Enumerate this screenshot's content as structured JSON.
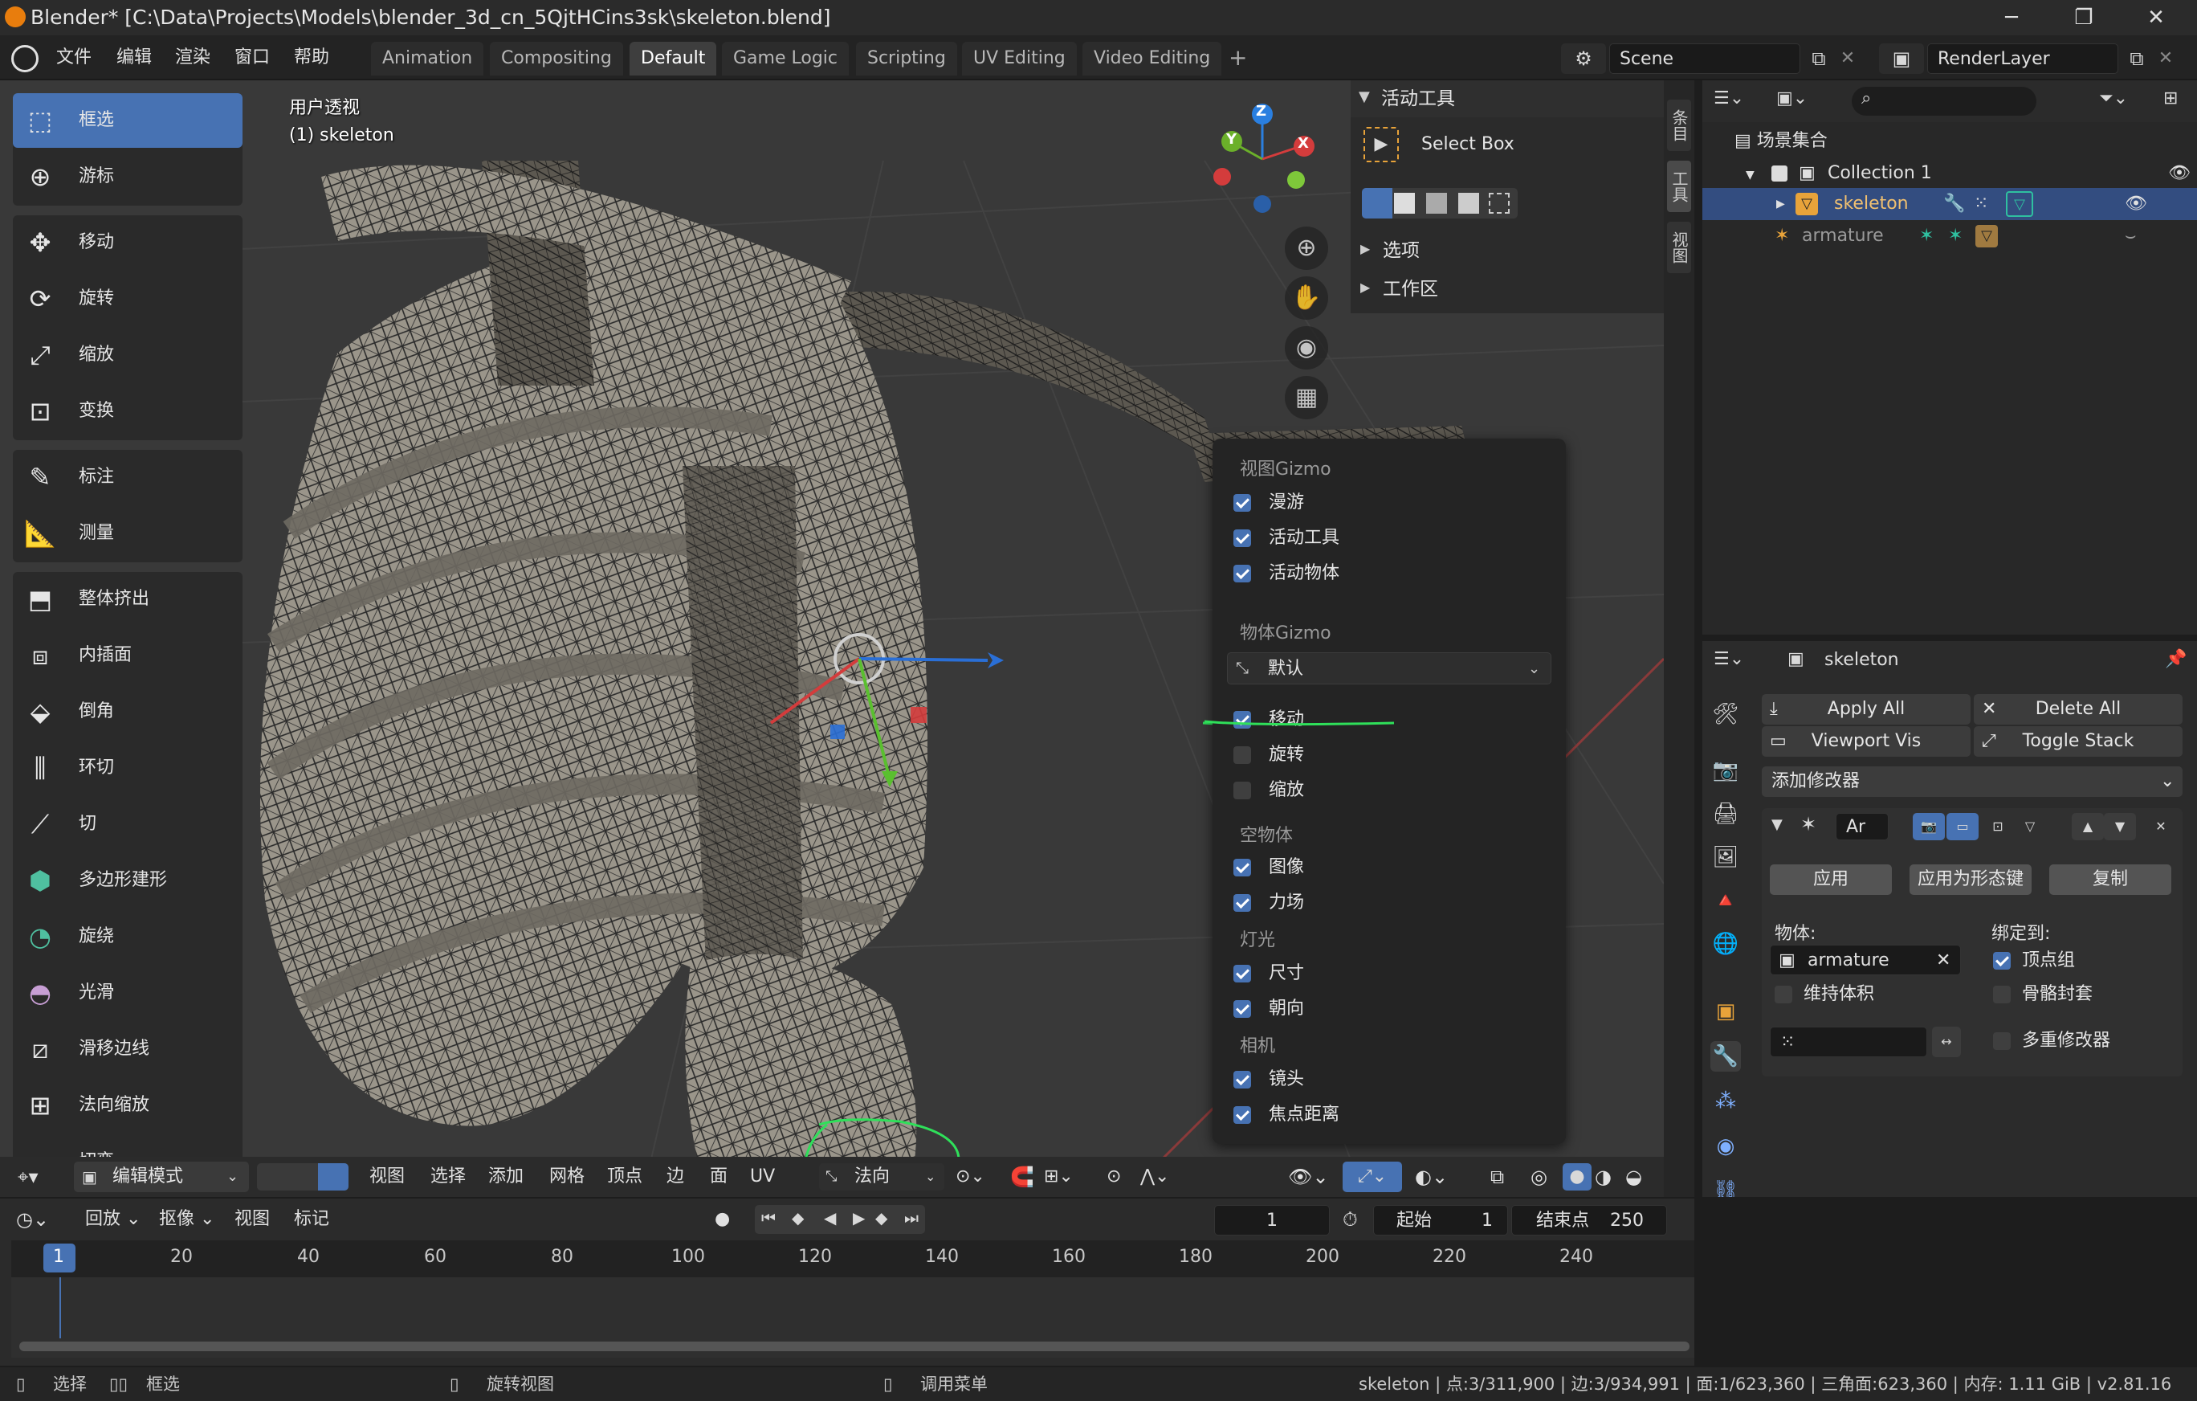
{
  "window": {
    "title": "Blender* [C:\\Data\\Projects\\Models\\blender_3d_cn_5QjtHCins3sk\\skeleton.blend]",
    "minimize": "─",
    "maximize": "❐",
    "close": "✕"
  },
  "menubar": {
    "menus": [
      "文件",
      "编辑",
      "渲染",
      "窗口",
      "帮助"
    ],
    "workspaces": [
      "Animation",
      "Compositing",
      "Default",
      "Game Logic",
      "Scripting",
      "UV Editing",
      "Video Editing"
    ],
    "active_workspace": "Default",
    "add_tab": "+",
    "scene": "Scene",
    "render_layer": "RenderLayer"
  },
  "viewport": {
    "view_name": "用户透视",
    "object_info": "(1) skeleton",
    "tools": [
      "框选",
      "游标",
      "移动",
      "旋转",
      "缩放",
      "变换",
      "标注",
      "测量",
      "整体挤出",
      "内插面",
      "倒角",
      "环切",
      "切",
      "多边形建形",
      "旋绕",
      "光滑",
      "滑移边线",
      "法向缩放",
      "切变"
    ],
    "active_tool": "框选",
    "gizmo_axes": {
      "x": "X",
      "y": "Y",
      "z": "Z"
    }
  },
  "npanel": {
    "section_active_tool": "活动工具",
    "tool_name": "Select Box",
    "section_options": "选项",
    "section_workspace": "工作区",
    "tabs": [
      "条目",
      "工具",
      "视图"
    ]
  },
  "gizmo_popover": {
    "viewport_gizmo_header": "视图Gizmo",
    "viewport_items": [
      {
        "label": "漫游",
        "checked": true
      },
      {
        "label": "活动工具",
        "checked": true
      },
      {
        "label": "活动物体",
        "checked": true
      }
    ],
    "object_gizmo_header": "物体Gizmo",
    "orientation": "默认",
    "object_items": [
      {
        "label": "移动",
        "checked": true
      },
      {
        "label": "旋转",
        "checked": false
      },
      {
        "label": "缩放",
        "checked": false
      }
    ],
    "empty_header": "空物体",
    "empty_items": [
      {
        "label": "图像",
        "checked": true
      },
      {
        "label": "力场",
        "checked": true
      }
    ],
    "light_header": "灯光",
    "light_items": [
      {
        "label": "尺寸",
        "checked": true
      },
      {
        "label": "朝向",
        "checked": true
      }
    ],
    "camera_header": "相机",
    "camera_items": [
      {
        "label": "镜头",
        "checked": true
      },
      {
        "label": "焦点距离",
        "checked": true
      }
    ]
  },
  "viewport_header": {
    "mode": "编辑模式",
    "menus": [
      "视图",
      "选择",
      "添加",
      "网格",
      "顶点",
      "边",
      "面",
      "UV"
    ],
    "orientation": "法向"
  },
  "outliner": {
    "scene_collection": "场景集合",
    "collection": "Collection 1",
    "skeleton": "skeleton",
    "armature": "armature"
  },
  "properties": {
    "object_name": "skeleton",
    "apply_all": "Apply All",
    "delete_all": "Delete All",
    "viewport_vis": "Viewport Vis",
    "toggle_stack": "Toggle Stack",
    "add_modifier": "添加修改器",
    "modifier_name": "Ar",
    "apply": "应用",
    "apply_as_shape": "应用为形态键",
    "copy": "复制",
    "object_label": "物体:",
    "object_value": "armature",
    "bind_to_label": "绑定到:",
    "preserve_volume": "维持体积",
    "vertex_groups": "顶点组",
    "bone_envelopes": "骨骼封套",
    "multi_modifier": "多重修改器"
  },
  "timeline": {
    "menus": [
      "回放",
      "抠像",
      "视图",
      "标记"
    ],
    "current_frame": "1",
    "start_label": "起始",
    "start_value": "1",
    "end_label": "结束点",
    "end_value": "250",
    "ruler": [
      "1",
      "20",
      "40",
      "60",
      "80",
      "100",
      "120",
      "140",
      "160",
      "180",
      "200",
      "220",
      "240"
    ]
  },
  "statusbar": {
    "select": "选择",
    "box_select": "框选",
    "rotate_view": "旋转视图",
    "call_menu": "调用菜单",
    "stats": "skeleton | 点:3/311,900 | 边:3/934,991 | 面:1/623,360 | 三角面:623,360 | 内存: 1.11 GiB | v2.81.16"
  },
  "colors": {
    "accent_blue": "#4772b3",
    "annotation_green": "#2fe05a",
    "selected_orange": "#e8a33a"
  }
}
